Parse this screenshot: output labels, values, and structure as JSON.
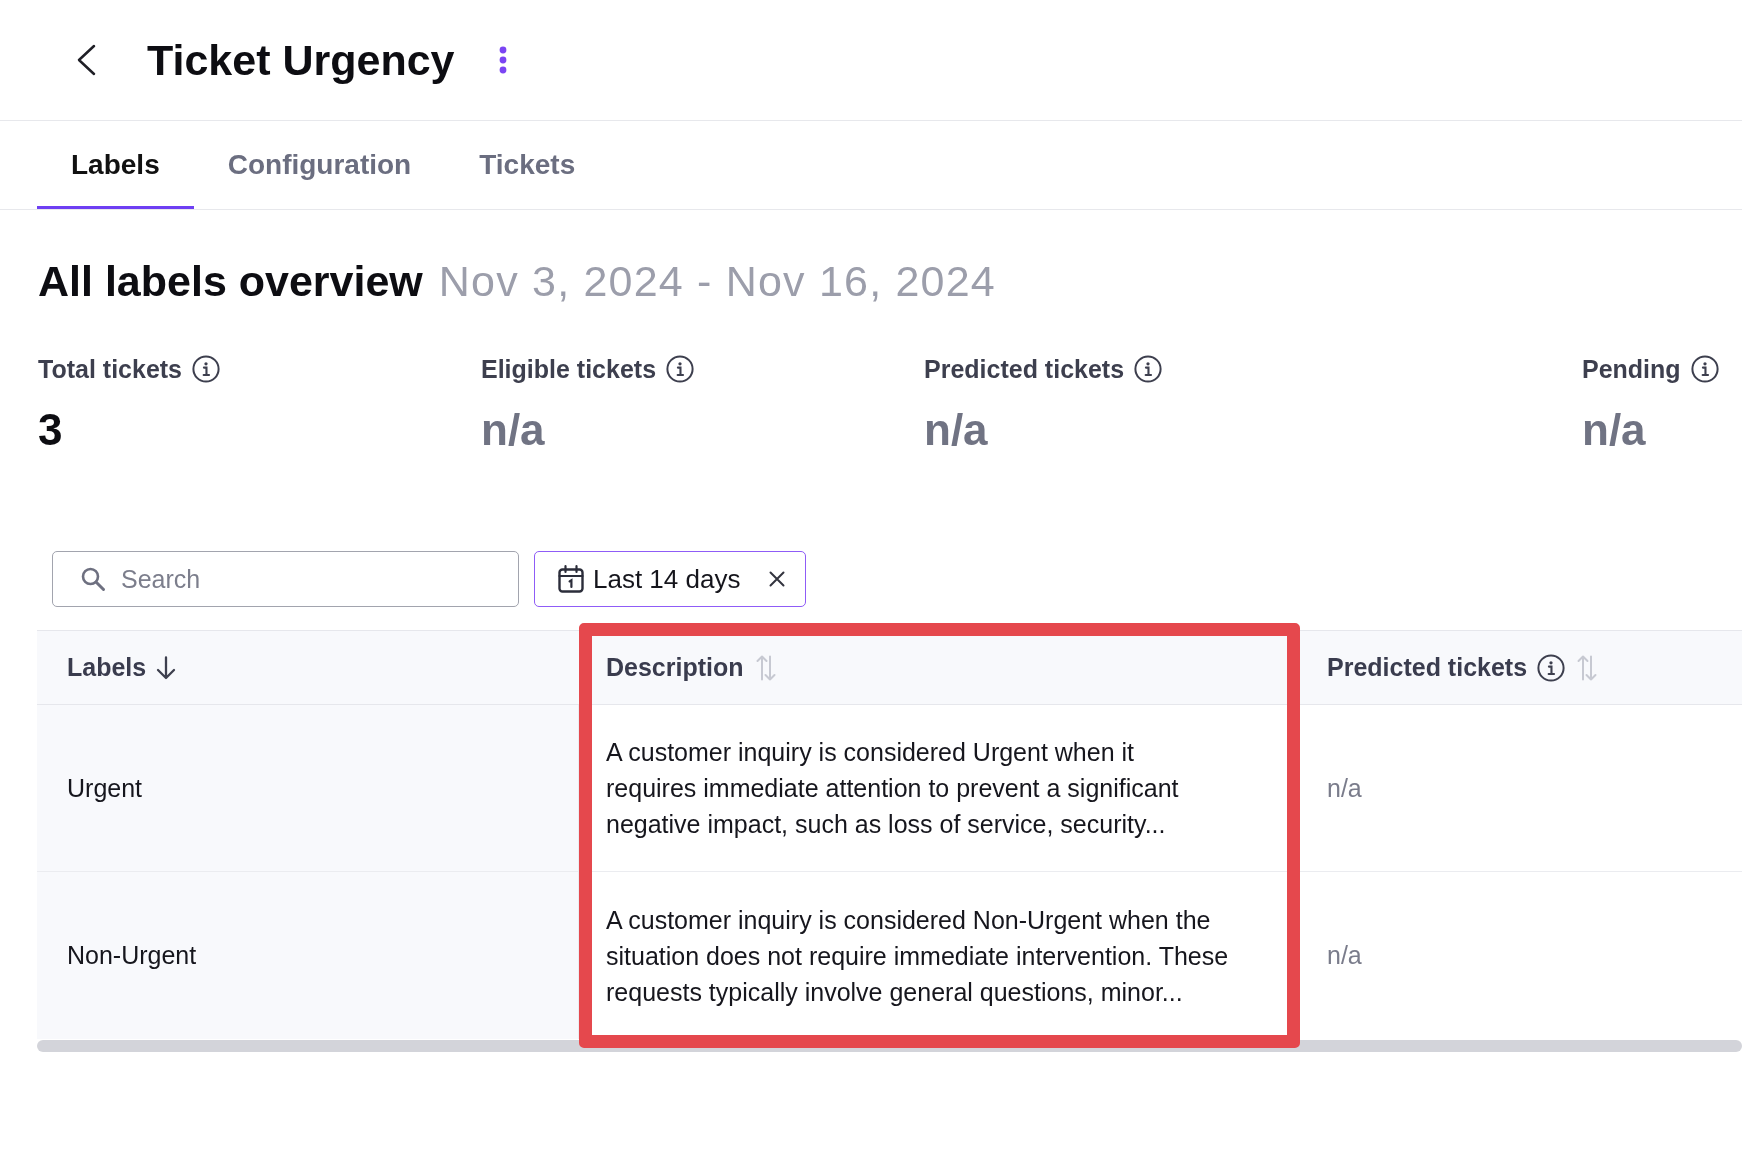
{
  "header": {
    "title": "Ticket Urgency"
  },
  "tabs": [
    {
      "label": "Labels",
      "selected": true
    },
    {
      "label": "Configuration",
      "selected": false
    },
    {
      "label": "Tickets",
      "selected": false
    }
  ],
  "overview": {
    "title": "All labels overview",
    "date_range": "Nov 3, 2024 - Nov 16, 2024"
  },
  "stats": [
    {
      "label": "Total tickets",
      "value": "3",
      "muted": false
    },
    {
      "label": "Eligible tickets",
      "value": "n/a",
      "muted": true
    },
    {
      "label": "Predicted tickets",
      "value": "n/a",
      "muted": true
    },
    {
      "label": "Pending",
      "value": "n/a",
      "muted": true
    }
  ],
  "filters": {
    "search": {
      "placeholder": "Search"
    },
    "date_filter": {
      "label": "Last 14 days"
    }
  },
  "table": {
    "columns": [
      {
        "label": "Labels",
        "kind": "label",
        "sorted": true,
        "info": false,
        "highlighted": false
      },
      {
        "label": "Description",
        "kind": "text",
        "sorted": false,
        "info": false,
        "highlighted": true
      },
      {
        "label": "Predicted tickets",
        "kind": "metric",
        "sorted": false,
        "info": true,
        "highlighted": false
      }
    ],
    "rows": [
      {
        "cells": [
          "Urgent",
          "A customer inquiry is considered Urgent when it requires immediate attention to prevent a significant negative impact, such as loss of service, security...",
          "n/a"
        ]
      },
      {
        "cells": [
          "Non-Urgent",
          "A customer inquiry is considered Non-Urgent when the situation does not require immediate intervention. These requests typically involve general questions, minor...",
          "n/a"
        ]
      }
    ]
  }
}
